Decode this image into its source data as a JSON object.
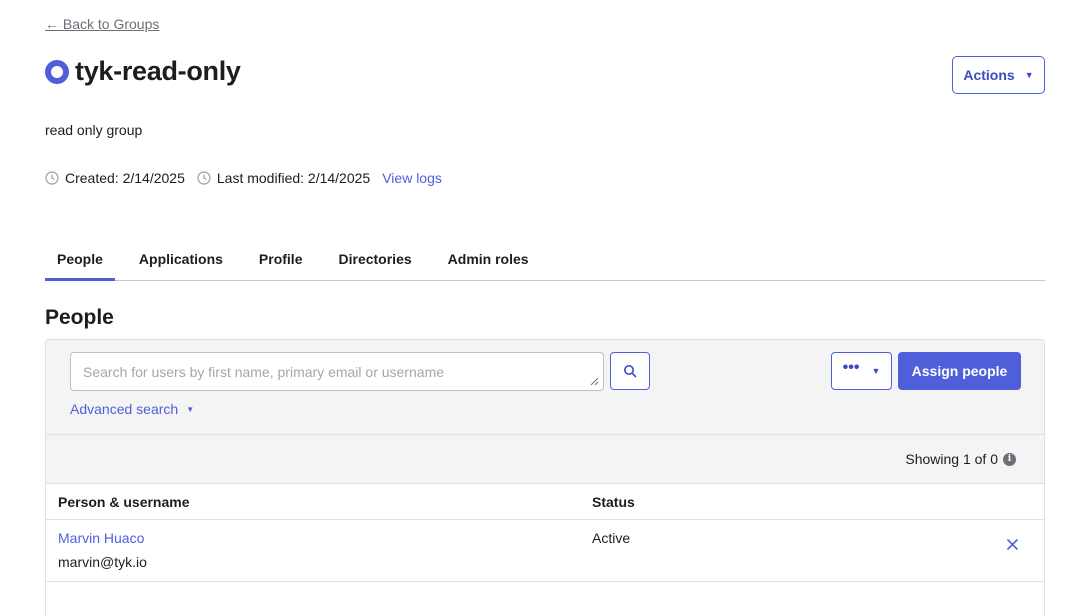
{
  "nav": {
    "back_label": "← Back to Groups"
  },
  "group": {
    "name": "tyk-read-only",
    "description": "read only group",
    "created": "Created: 2/14/2025",
    "modified": "Last modified: 2/14/2025",
    "view_logs": "View logs"
  },
  "header": {
    "actions_label": "Actions"
  },
  "tabs": [
    {
      "label": "People",
      "active": true
    },
    {
      "label": "Applications",
      "active": false
    },
    {
      "label": "Profile",
      "active": false
    },
    {
      "label": "Directories",
      "active": false
    },
    {
      "label": "Admin roles",
      "active": false
    }
  ],
  "people": {
    "title": "People",
    "search_placeholder": "Search for users by first name, primary email or username",
    "advanced_search": "Advanced search",
    "assign_label": "Assign people",
    "more_label": "•••",
    "showing": "Showing 1 of 0",
    "columns": {
      "person": "Person & username",
      "status": "Status"
    },
    "rows": [
      {
        "name": "Marvin Huaco",
        "email": "marvin@tyk.io",
        "status": "Active"
      }
    ]
  },
  "colors": {
    "accent": "#4f5fd9",
    "text": "#1d1d21",
    "muted": "#6e6e78",
    "panel_bg": "#f4f4f5"
  },
  "icons": [
    "group-icon",
    "clock-icon",
    "search-icon",
    "caret-down-icon",
    "info-icon",
    "close-icon"
  ]
}
